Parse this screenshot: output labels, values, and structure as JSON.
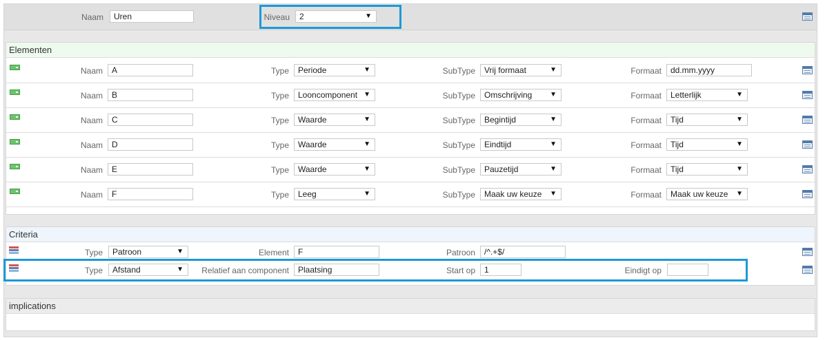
{
  "header": {
    "naam_label": "Naam",
    "naam_value": "Uren",
    "niveau_label": "Niveau",
    "niveau_value": "2"
  },
  "elementen": {
    "title": "Elementen",
    "naam_label": "Naam",
    "type_label": "Type",
    "subtype_label": "SubType",
    "formaat_label": "Formaat",
    "rows": [
      {
        "naam": "A",
        "type": "Periode",
        "subtype": "Vrij formaat",
        "formaat": "dd.mm.yyyy",
        "formaat_kind": "input"
      },
      {
        "naam": "B",
        "type": "Looncomponent",
        "subtype": "Omschrijving",
        "formaat": "Letterlijk",
        "formaat_kind": "select"
      },
      {
        "naam": "C",
        "type": "Waarde",
        "subtype": "Begintijd",
        "formaat": "Tijd",
        "formaat_kind": "select"
      },
      {
        "naam": "D",
        "type": "Waarde",
        "subtype": "Eindtijd",
        "formaat": "Tijd",
        "formaat_kind": "select"
      },
      {
        "naam": "E",
        "type": "Waarde",
        "subtype": "Pauzetijd",
        "formaat": "Tijd",
        "formaat_kind": "select"
      },
      {
        "naam": "F",
        "type": "Leeg",
        "subtype": "Maak uw keuze",
        "formaat": "Maak uw keuze",
        "formaat_kind": "select"
      }
    ]
  },
  "criteria": {
    "title": "Criteria",
    "row1": {
      "type_label": "Type",
      "type_value": "Patroon",
      "element_label": "Element",
      "element_value": "F",
      "patroon_label": "Patroon",
      "patroon_value": "/^.+$/"
    },
    "row2": {
      "type_label": "Type",
      "type_value": "Afstand",
      "relatief_label": "Relatief aan component",
      "relatief_value": "Plaatsing",
      "startop_label": "Start op",
      "startop_value": "1",
      "eindigtop_label": "Eindigt op",
      "eindigtop_value": ""
    }
  },
  "implications": {
    "title": "implications"
  },
  "colors": {
    "highlight": "#1a9ad6",
    "elementen_header_bg": "#eefaee",
    "criteria_header_bg": "#eef5fc"
  }
}
